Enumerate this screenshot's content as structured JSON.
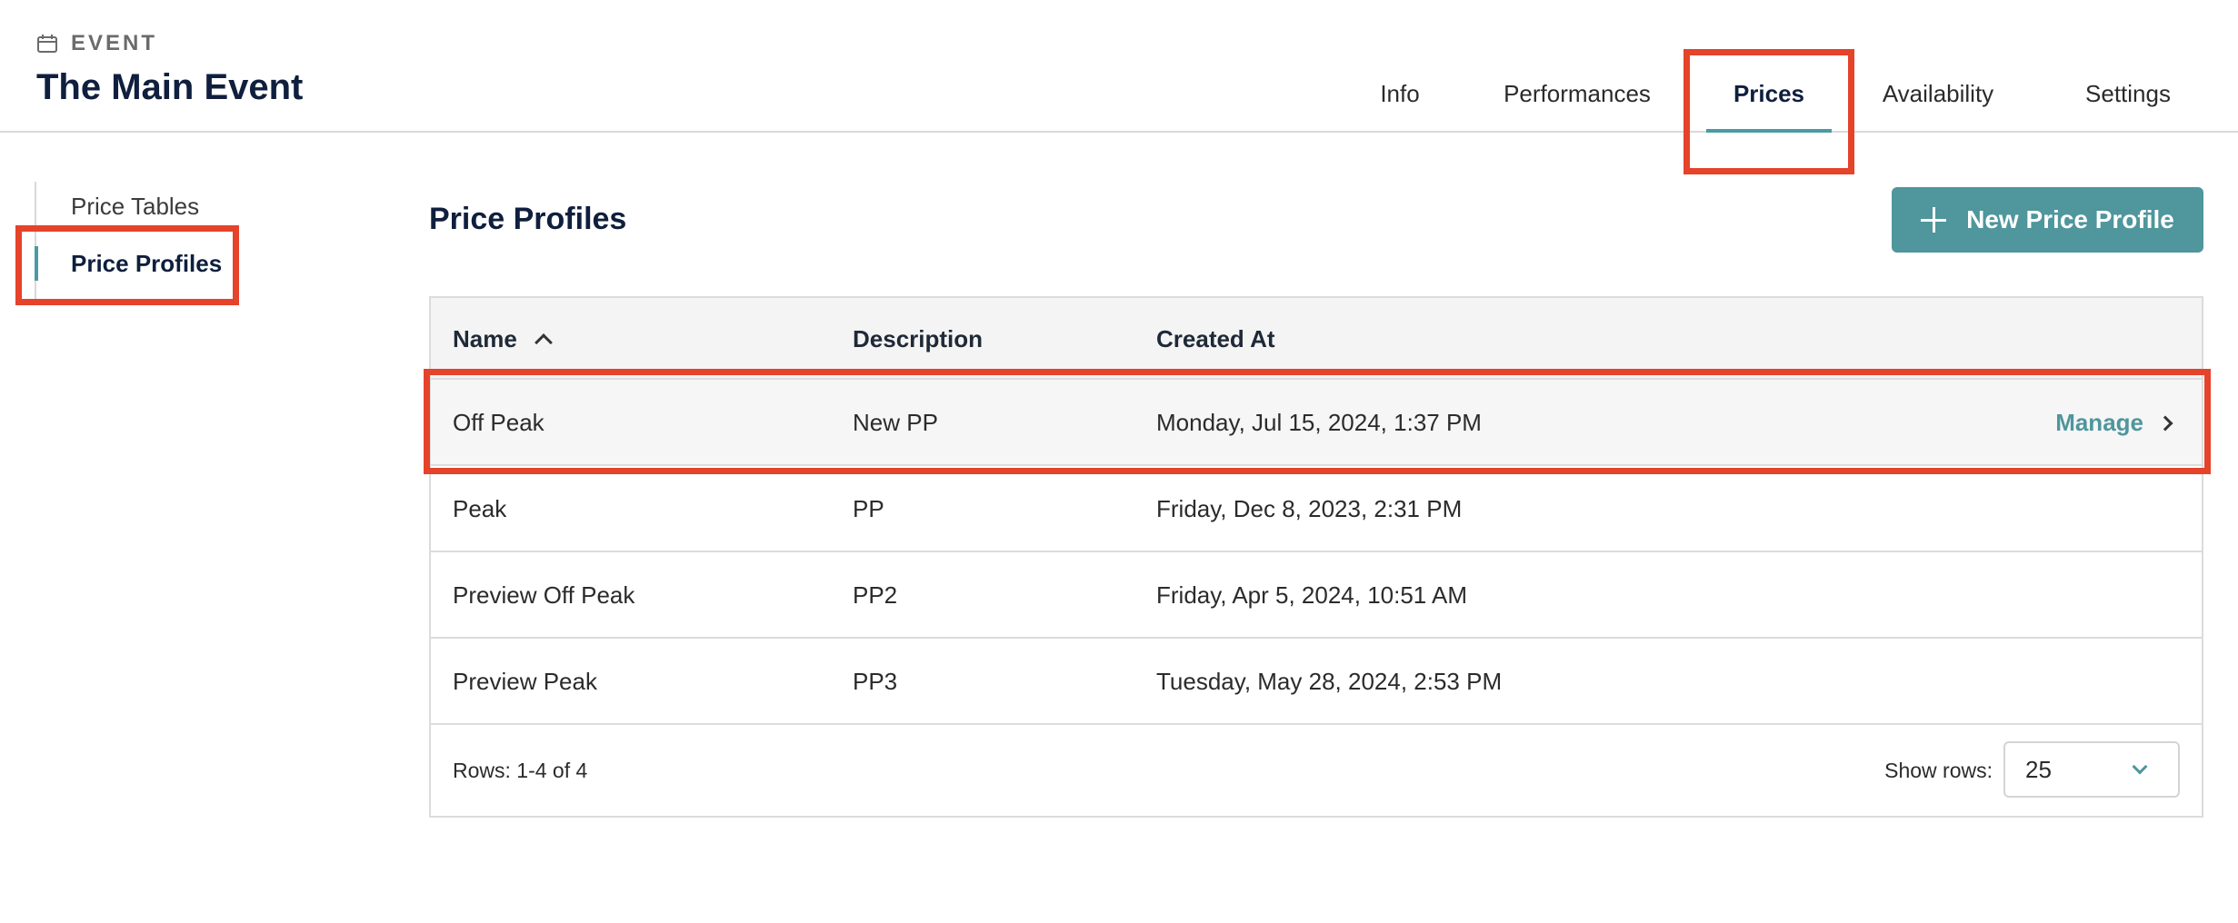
{
  "header": {
    "eyebrow_icon": "calendar-icon",
    "eyebrow_label": "EVENT",
    "title": "The Main Event"
  },
  "tabs": [
    {
      "label": "Info",
      "active": false
    },
    {
      "label": "Performances",
      "active": false
    },
    {
      "label": "Prices",
      "active": true
    },
    {
      "label": "Availability",
      "active": false
    },
    {
      "label": "Settings",
      "active": false
    }
  ],
  "sidebar": {
    "items": [
      {
        "label": "Price Tables",
        "active": false
      },
      {
        "label": "Price Profiles",
        "active": true
      }
    ]
  },
  "main": {
    "title": "Price Profiles",
    "new_button_label": "New Price Profile",
    "table": {
      "columns": [
        "Name",
        "Description",
        "Created At"
      ],
      "sort_column": "Name",
      "sort_direction": "ascending",
      "rows": [
        {
          "name": "Off Peak",
          "description": "New PP",
          "created_at": "Monday, Jul 15, 2024, 1:37 PM",
          "action": "Manage"
        },
        {
          "name": "Peak",
          "description": "PP",
          "created_at": "Friday, Dec 8, 2023, 2:31 PM"
        },
        {
          "name": "Preview Off Peak",
          "description": "PP2",
          "created_at": "Friday, Apr 5, 2024, 10:51 AM"
        },
        {
          "name": "Preview Peak",
          "description": "PP3",
          "created_at": "Tuesday, May 28, 2024, 2:53 PM"
        }
      ]
    },
    "footer": {
      "rows_info": "Rows: 1-4 of 4",
      "show_rows_label": "Show rows:",
      "show_rows_value": "25"
    }
  },
  "colors": {
    "accent": "#4f969d",
    "highlight": "#e5432a",
    "title": "#0f1f3d"
  }
}
